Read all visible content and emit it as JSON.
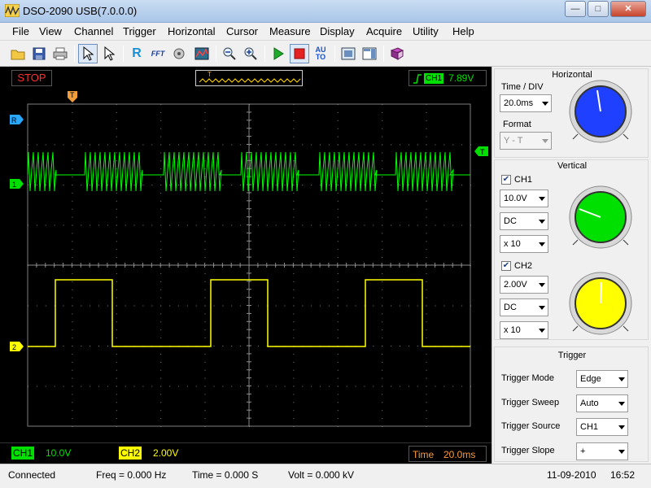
{
  "window": {
    "title": "DSO-2090 USB(7.0.0.0)"
  },
  "menu": [
    "File",
    "View",
    "Channel",
    "Trigger",
    "Horizontal",
    "Cursor",
    "Measure",
    "Display",
    "Acquire",
    "Utility",
    "Help"
  ],
  "toolbar": {
    "icons": [
      "open-folder-icon",
      "save-icon",
      "print-icon",
      "select-arrow-icon",
      "pointer-arrow-icon",
      "reference-icon",
      "fft-icon",
      "math-icon",
      "display-icon",
      "zoom-out-icon",
      "zoom-in-icon",
      "run-icon",
      "stop-icon",
      "auto-icon",
      "fullscreen-icon",
      "panel-toggle-icon",
      "book-icon"
    ],
    "ref_glyph": "R",
    "fft_glyph": "FFT",
    "auto_top": "AU",
    "auto_bottom": "TO"
  },
  "status_strip": {
    "run_state": "STOP",
    "trigger_channel": "CH1",
    "trigger_level": "7.89V",
    "preview_t": "T"
  },
  "scope": {
    "markers": {
      "trigger_pos": "T",
      "ref": "R",
      "ch1": "1",
      "ch2": "2",
      "trigger_level": "T"
    },
    "ch1_color": "#00ff00",
    "ch2_color": "#ffff00"
  },
  "channel_bar": {
    "ch1_label": "CH1",
    "ch1_scale": "10.0V",
    "ch2_label": "CH2",
    "ch2_scale": "2.00V",
    "time_label": "Time",
    "time_value": "20.0ms"
  },
  "horizontal": {
    "title": "Horizontal",
    "time_div_label": "Time / DIV",
    "time_div_value": "20.0ms",
    "format_label": "Format",
    "format_value": "Y - T",
    "knob_color": "#2040ff"
  },
  "vertical": {
    "title": "Vertical",
    "ch1": {
      "label": "CH1",
      "checked": true,
      "volts": "10.0V",
      "coupling": "DC",
      "probe": "x 10",
      "knob_color": "#00e000"
    },
    "ch2": {
      "label": "CH2",
      "checked": true,
      "volts": "2.00V",
      "coupling": "DC",
      "probe": "x 10",
      "knob_color": "#ffff00"
    }
  },
  "trigger": {
    "title": "Trigger",
    "mode_label": "Trigger Mode",
    "mode_value": "Edge",
    "sweep_label": "Trigger Sweep",
    "sweep_value": "Auto",
    "source_label": "Trigger Source",
    "source_value": "CH1",
    "slope_label": "Trigger Slope",
    "slope_value": "+"
  },
  "statusbar": {
    "connection": "Connected",
    "freq": "Freq = 0.000 Hz",
    "time": "Time = 0.000 S",
    "volt": "Volt = 0.000 kV",
    "date": "11-09-2010",
    "clock": "16:52"
  }
}
